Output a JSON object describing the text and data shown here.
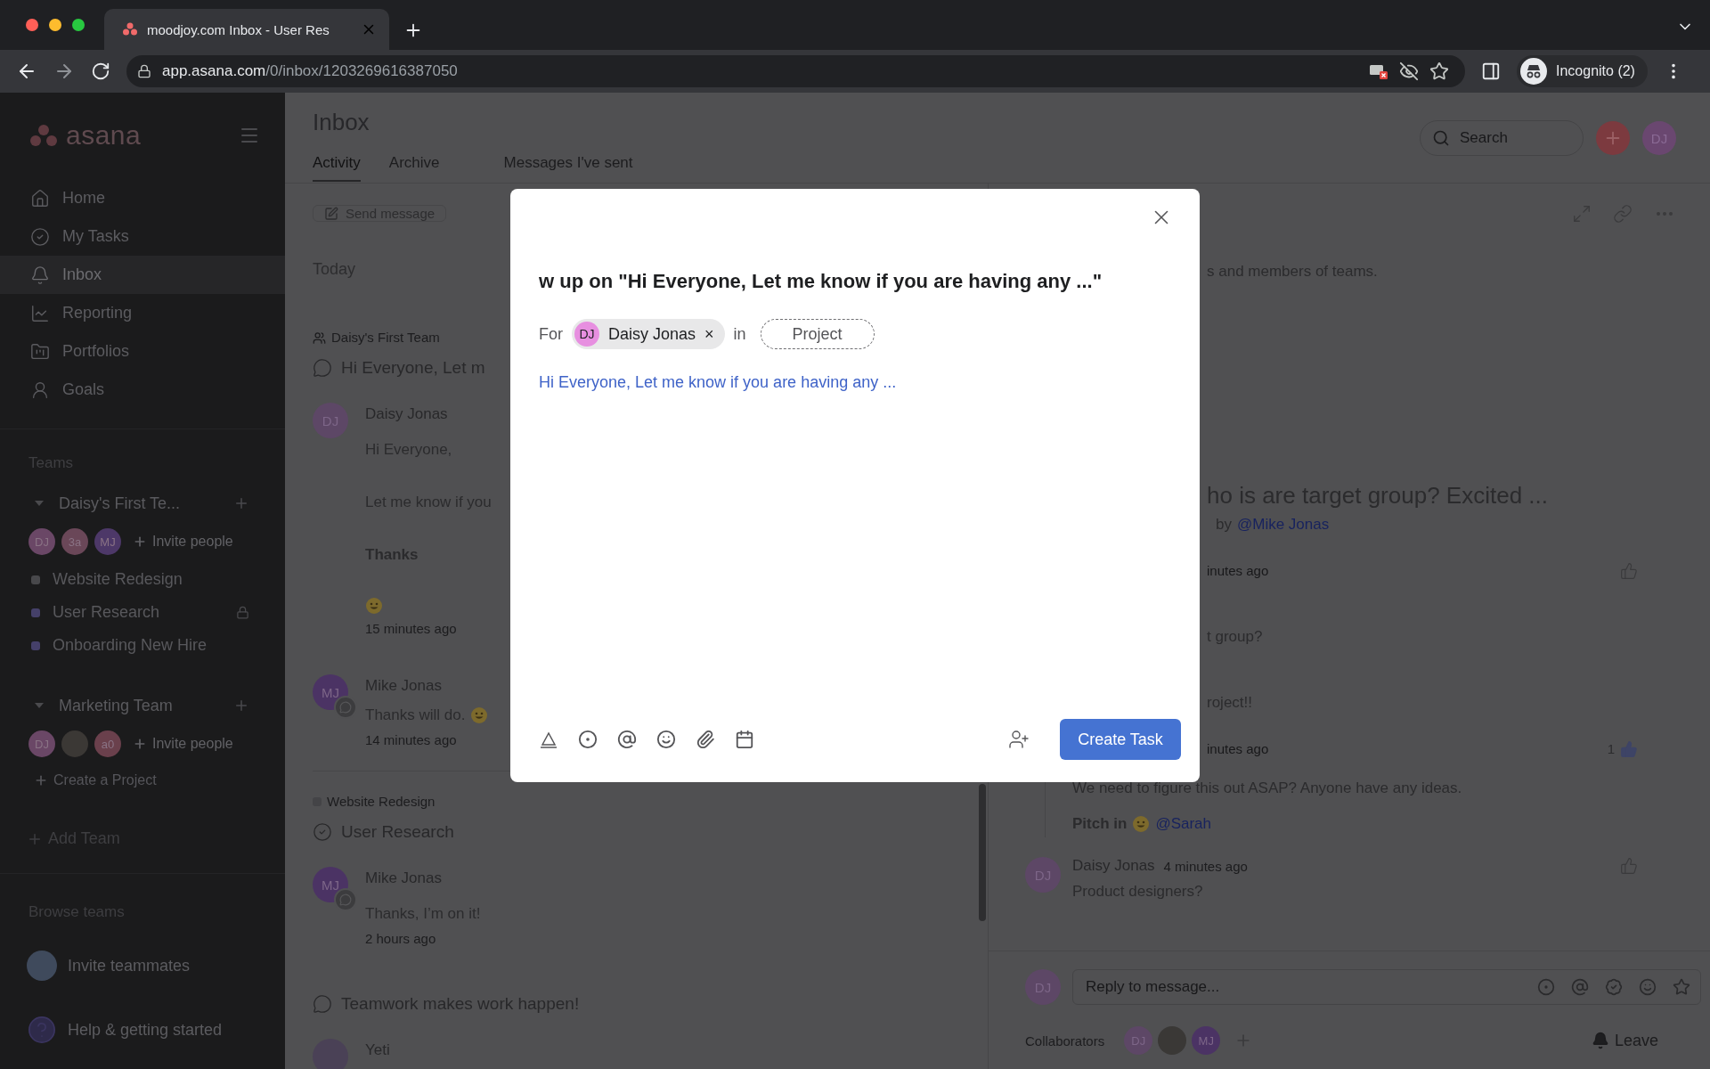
{
  "browser": {
    "tabs": [
      {
        "title": "moodjoy.com Inbox - User Res",
        "selected": true
      }
    ],
    "url": {
      "host": "app.asana.com",
      "path": "/0/inbox/1203269616387050"
    },
    "profile": "Incognito (2)"
  },
  "sidebar": {
    "logo": "asana",
    "nav": [
      {
        "label": "Home",
        "selected": false
      },
      {
        "label": "My Tasks",
        "selected": false
      },
      {
        "label": "Inbox",
        "selected": true
      },
      {
        "label": "Reporting",
        "selected": false
      },
      {
        "label": "Portfolios",
        "selected": false
      },
      {
        "label": "Goals",
        "selected": false
      }
    ],
    "teams_heading": "Teams",
    "teams": [
      {
        "name": "Daisy's First Te...",
        "expanded": true,
        "members": [
          {
            "kind": "initials",
            "text": "DJ",
            "color": "#6a4766"
          },
          {
            "kind": "initials",
            "text": "3a",
            "color": "#6a4758"
          },
          {
            "kind": "initials",
            "text": "MJ",
            "color": "#4d3868"
          }
        ],
        "invite": "Invite people",
        "projects": [
          {
            "name": "Website Redesign",
            "color": "#48484b",
            "locked": false
          },
          {
            "name": "User Research",
            "color": "#454069",
            "locked": true
          },
          {
            "name": "Onboarding New Hire",
            "color": "#454069",
            "locked": false
          }
        ]
      },
      {
        "name": "Marketing Team",
        "expanded": true,
        "members": [
          {
            "kind": "initials",
            "text": "DJ",
            "color": "#6a4766"
          },
          {
            "kind": "photo",
            "color": "#3b3835"
          },
          {
            "kind": "initials",
            "text": "a0",
            "color": "#6a404c"
          }
        ],
        "invite": "Invite people",
        "action": "Create a Project"
      }
    ],
    "add_team": "Add Team",
    "browse_teams": "Browse teams",
    "invite_teammates": "Invite teammates",
    "help": "Help & getting started"
  },
  "header": {
    "title": "Inbox",
    "tabs": [
      {
        "label": "Activity",
        "selected": true
      },
      {
        "label": "Archive",
        "selected": false
      },
      {
        "label": "Messages I've sent",
        "selected": false
      }
    ],
    "search": {
      "placeholder": "Search"
    },
    "user": {
      "kind": "initials",
      "text": "DJ",
      "color": "#6a4770"
    }
  },
  "list": {
    "send_message": "Send message",
    "section": "Today",
    "threads": [
      {
        "kind": "message",
        "context": {
          "kind": "team",
          "text": "Daisy's First Team"
        },
        "title": "Hi Everyone, Let m",
        "comments": [
          {
            "avatar": {
              "kind": "initials",
              "text": "DJ",
              "color": "#5d4766"
            },
            "author": "Daisy Jonas",
            "badge": false,
            "lines": [
              {
                "kind": "text",
                "text": "Hi Everyone,"
              },
              {
                "kind": "text",
                "text": "Let me know if you"
              },
              {
                "kind": "bold",
                "text": "Thanks"
              },
              {
                "kind": "emoji"
              }
            ],
            "time": "15 minutes ago"
          },
          {
            "avatar": {
              "kind": "initials",
              "text": "MJ",
              "color": "#4b3364"
            },
            "author": "Mike Jonas",
            "badge": true,
            "lines": [
              {
                "kind": "text_emoji",
                "text": "Thanks will do."
              }
            ],
            "time": "14 minutes ago"
          }
        ]
      },
      {
        "kind": "task",
        "context": {
          "kind": "project",
          "text": "Website Redesign"
        },
        "title": "User Research",
        "comments": [
          {
            "avatar": {
              "kind": "initials",
              "text": "MJ",
              "color": "#4b3364"
            },
            "author": "Mike Jonas",
            "badge": true,
            "lines": [
              {
                "kind": "text",
                "text": "Thanks, I’m on it!"
              }
            ],
            "time": "2 hours ago"
          }
        ]
      },
      {
        "kind": "message",
        "title": "Teamwork makes work happen!",
        "comments": [
          {
            "avatar": {
              "kind": "photo",
              "color": "#4a4156"
            },
            "author": "Yeti",
            "badge": false
          }
        ]
      }
    ]
  },
  "detail": {
    "rows": [
      {
        "kind": "intro",
        "text": "s and members of teams."
      },
      {
        "kind": "title",
        "text": "ho is are target group? Excited ..."
      },
      {
        "kind": "byline",
        "text": "by",
        "link": "@Mike Jonas"
      },
      {
        "kind": "meta",
        "time": "inutes ago",
        "liked": false
      },
      {
        "kind": "body",
        "text": "t group?"
      },
      {
        "kind": "body",
        "text": "roject!!"
      },
      {
        "kind": "meta",
        "time": "inutes ago",
        "likes": "1",
        "liked": true
      }
    ],
    "thread": {
      "text": "We need to figure this out ASAP? Anyone have any ideas.",
      "pitch": "Pitch in",
      "mention": "@Sarah"
    },
    "comment": {
      "avatar": {
        "kind": "initials",
        "text": "DJ",
        "color": "#5d4766"
      },
      "author": "Daisy Jonas",
      "time": "4 minutes ago",
      "text": "Product designers?",
      "liked": false
    },
    "reply": {
      "avatar": {
        "kind": "initials",
        "text": "DJ",
        "color": "#5d4766"
      },
      "placeholder": "Reply to message..."
    },
    "collaborators": {
      "label": "Collaborators",
      "members": [
        {
          "kind": "initials",
          "text": "DJ",
          "color": "#5d4766"
        },
        {
          "kind": "photo",
          "color": "#3a3836"
        },
        {
          "kind": "initials",
          "text": "MJ",
          "color": "#4b3364"
        }
      ],
      "leave": "Leave"
    }
  },
  "modal": {
    "title": "w up on \"Hi Everyone, Let me know if you are having any ...\"",
    "for_label": "For",
    "assignee": {
      "initials": "DJ",
      "name": "Daisy Jonas",
      "remove": "×"
    },
    "in_label": "in",
    "project": "Project",
    "description": "Hi Everyone, Let me know if you are having any ...",
    "submit": "Create Task"
  }
}
